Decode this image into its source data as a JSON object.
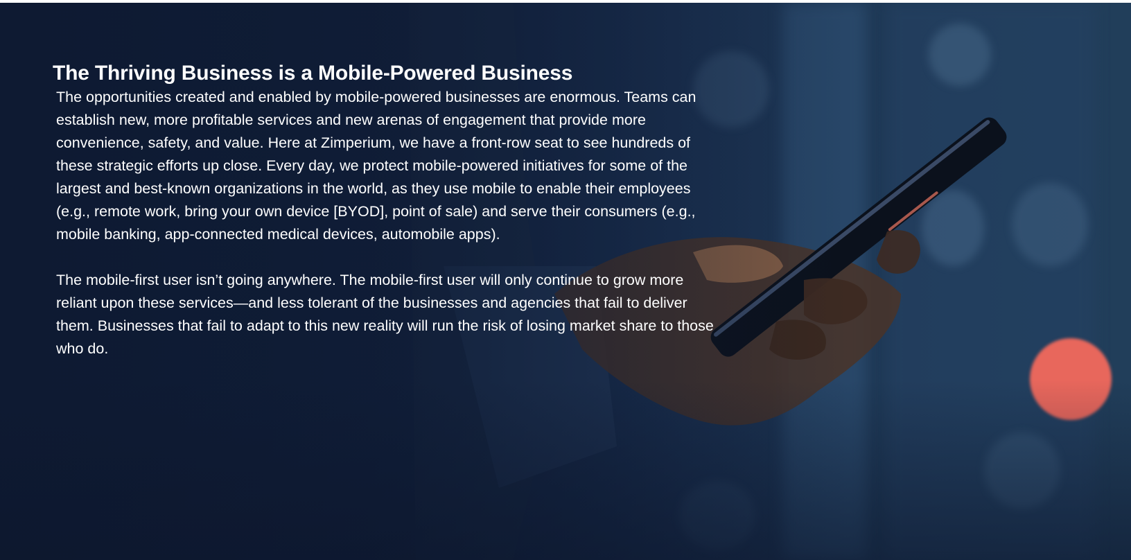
{
  "page": {
    "title": "The Thriving Business is a Mobile-Powered Business",
    "paragraphs": [
      "The opportunities created and enabled by mobile-powered businesses are enormous. Teams can establish new, more profitable services and new arenas of engagement that provide more convenience, safety, and value. Here at Zimperium, we have a front-row seat to see hundreds of these strategic efforts up close. Every day, we protect mobile-powered initiatives for some of the largest and best-known organizations in the world, as they use mobile to enable their employees (e.g., remote work, bring your own device [BYOD], point of sale) and serve their consumers (e.g., mobile banking, app-connected medical devices, automobile apps).",
      "The mobile-first user isn’t going anywhere. The mobile-first user will only continue to grow more reliant upon these services—and less tolerant of the businesses and agencies that fail to deliver them. Businesses that fail to adapt to this new reality will run the risk of losing market share to those who do."
    ]
  },
  "colors": {
    "background": "#132443",
    "text": "#ffffff",
    "bokeh_accent": "#e8675c"
  },
  "background_image": {
    "icon": "hand-holding-smartphone-photo"
  }
}
